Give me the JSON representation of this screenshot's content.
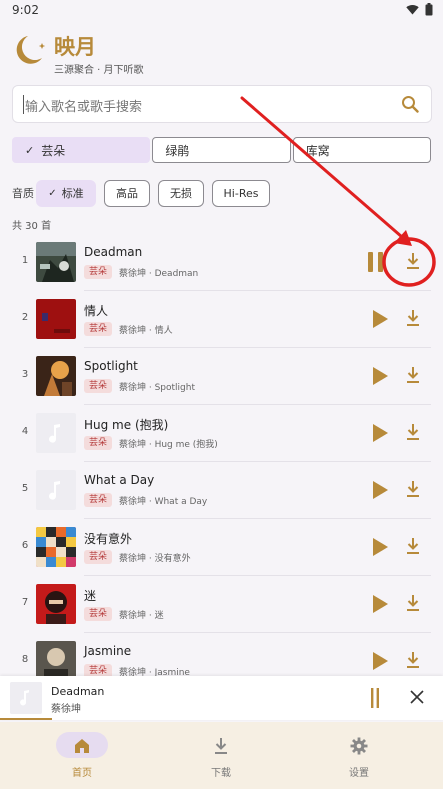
{
  "status": {
    "time": "9:02"
  },
  "app": {
    "title": "映月",
    "subtitle": "三源聚合 · 月下听歌",
    "brand_color": "#b78a3a"
  },
  "search": {
    "placeholder": "输入歌名或歌手搜索"
  },
  "sources": [
    {
      "label": "芸朵",
      "selected": true
    },
    {
      "label": "绿鹃",
      "selected": false
    },
    {
      "label": "库窝",
      "selected": false
    }
  ],
  "quality": {
    "label": "音质",
    "options": [
      {
        "label": "标准",
        "selected": true
      },
      {
        "label": "高品",
        "selected": false
      },
      {
        "label": "无损",
        "selected": false
      },
      {
        "label": "Hi-Res",
        "selected": false
      }
    ]
  },
  "count_text": "共 30 首",
  "songs": [
    {
      "num": "1",
      "title": "Deadman",
      "tag": "芸朵",
      "subtitle": "蔡徐坤 · Deadman",
      "playing": true
    },
    {
      "num": "2",
      "title": "情人",
      "tag": "芸朵",
      "subtitle": "蔡徐坤 · 情人",
      "playing": false
    },
    {
      "num": "3",
      "title": "Spotlight",
      "tag": "芸朵",
      "subtitle": "蔡徐坤 · Spotlight",
      "playing": false
    },
    {
      "num": "4",
      "title": "Hug me (抱我)",
      "tag": "芸朵",
      "subtitle": "蔡徐坤 · Hug me (抱我)",
      "playing": false
    },
    {
      "num": "5",
      "title": "What a Day",
      "tag": "芸朵",
      "subtitle": "蔡徐坤 · What a Day",
      "playing": false
    },
    {
      "num": "6",
      "title": "没有意外",
      "tag": "芸朵",
      "subtitle": "蔡徐坤 · 没有意外",
      "playing": false
    },
    {
      "num": "7",
      "title": "迷",
      "tag": "芸朵",
      "subtitle": "蔡徐坤 · 迷",
      "playing": false
    },
    {
      "num": "8",
      "title": "Jasmine",
      "tag": "芸朵",
      "subtitle": "蔡徐坤 · Jasmine",
      "playing": false
    }
  ],
  "mini_player": {
    "title": "Deadman",
    "artist": "蔡徐坤"
  },
  "nav": [
    {
      "label": "首页",
      "icon": "home-icon",
      "active": true
    },
    {
      "label": "下载",
      "icon": "download-icon",
      "active": false
    },
    {
      "label": "设置",
      "icon": "gear-icon",
      "active": false
    }
  ],
  "colors": {
    "accent_gold": "#b78a3a",
    "chip_selected": "#e9def5",
    "tag_red": "#b43a3a",
    "annotation_red": "#e02020"
  }
}
